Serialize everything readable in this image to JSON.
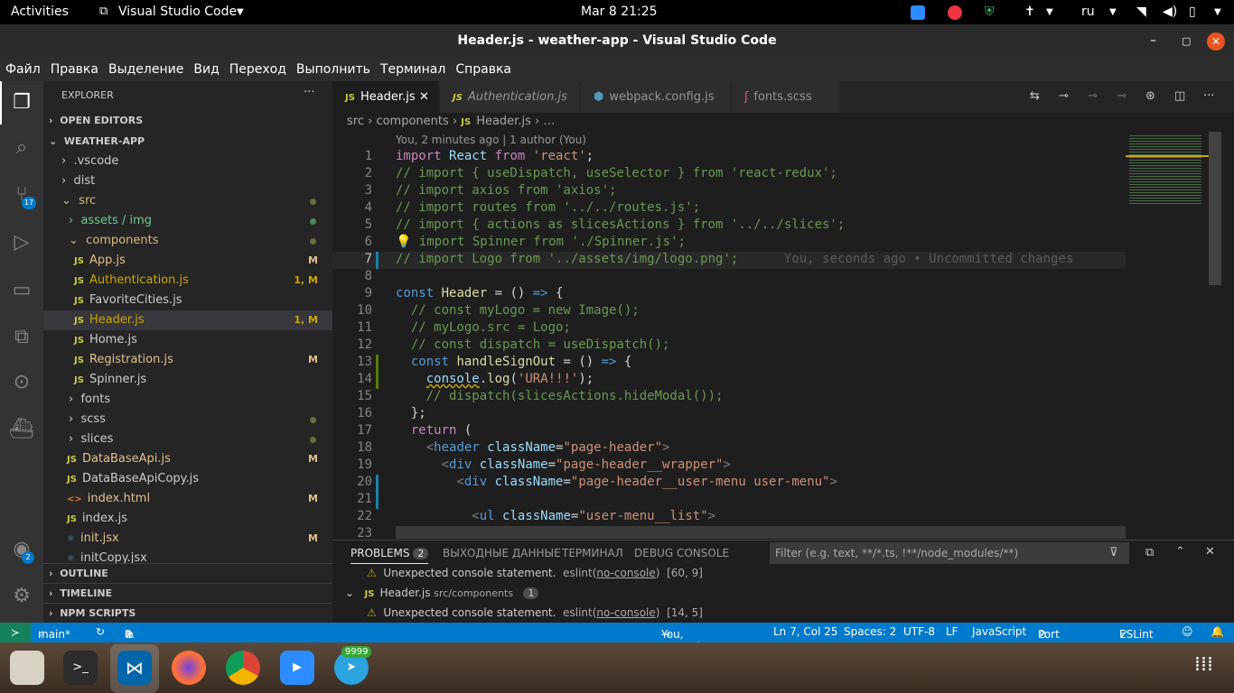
{
  "system": {
    "activities": "Activities",
    "app_menu": "Visual Studio Code",
    "clock": "Mar 8  21:25",
    "lang": "ru"
  },
  "window": {
    "title": "Header.js - weather-app - Visual Studio Code"
  },
  "menu": [
    "Файл",
    "Правка",
    "Выделение",
    "Вид",
    "Переход",
    "Выполнить",
    "Терминал",
    "Справка"
  ],
  "explorer": {
    "title": "EXPLORER",
    "open_editors": "OPEN EDITORS",
    "project": "WEATHER-APP",
    "items": [
      {
        "label": ".vscode",
        "kind": "folder"
      },
      {
        "label": "dist",
        "kind": "folder"
      },
      {
        "label": "src",
        "kind": "folder-open"
      },
      {
        "label": "assets / img",
        "kind": "folder"
      },
      {
        "label": "components",
        "kind": "folder-open"
      },
      {
        "label": "App.js",
        "kind": "js",
        "badge": "M"
      },
      {
        "label": "Authentication.js",
        "kind": "js",
        "badge": "1, M"
      },
      {
        "label": "FavoriteCities.js",
        "kind": "js",
        "badge": ""
      },
      {
        "label": "Header.js",
        "kind": "js",
        "badge": "1, M"
      },
      {
        "label": "Home.js",
        "kind": "js",
        "badge": ""
      },
      {
        "label": "Registration.js",
        "kind": "js",
        "badge": "M"
      },
      {
        "label": "Spinner.js",
        "kind": "js",
        "badge": ""
      },
      {
        "label": "fonts",
        "kind": "folder"
      },
      {
        "label": "scss",
        "kind": "folder"
      },
      {
        "label": "slices",
        "kind": "folder"
      },
      {
        "label": "DataBaseApi.js",
        "kind": "js",
        "badge": "M"
      },
      {
        "label": "DataBaseApiCopy.js",
        "kind": "js",
        "badge": ""
      },
      {
        "label": "index.html",
        "kind": "html",
        "badge": "M"
      },
      {
        "label": "index.js",
        "kind": "js",
        "badge": ""
      },
      {
        "label": "init.jsx",
        "kind": "jsx",
        "badge": "M"
      },
      {
        "label": "initCopy.jsx",
        "kind": "jsx",
        "badge": ""
      }
    ],
    "outline": "OUTLINE",
    "timeline": "TIMELINE",
    "npm": "NPM SCRIPTS"
  },
  "tabs": [
    {
      "label": "Header.js"
    },
    {
      "label": "Authentication.js"
    },
    {
      "label": "webpack.config.js"
    },
    {
      "label": "fonts.scss"
    }
  ],
  "breadcrumb": [
    "src",
    "components",
    "Header.js",
    "…"
  ],
  "blame": "You, 2 minutes ago | 1 author (You)",
  "inline_blame": "You, seconds ago • Uncommitted changes",
  "line_numbers": [
    "1",
    "2",
    "3",
    "4",
    "5",
    "6",
    "7",
    "8",
    "9",
    "10",
    "11",
    "12",
    "13",
    "14",
    "15",
    "16",
    "17",
    "18",
    "19",
    "20",
    "21",
    "22",
    "23"
  ],
  "panel": {
    "tabs": [
      "PROBLEMS",
      "ВЫХОДНЫЕ ДАННЫЕ",
      "ТЕРМИНАЛ",
      "DEBUG CONSOLE"
    ],
    "problems_count": "2",
    "filter_placeholder": "Filter (e.g. text, **/*.ts, !**/node_modules/**)",
    "row1": {
      "msg": "Unexpected console statement.",
      "src": "eslint(",
      "rule": "no-console",
      "end": ")",
      "pos": "[60, 9]"
    },
    "file": {
      "name": "Header.js",
      "path": "src/components",
      "count": "1"
    },
    "row2": {
      "msg": "Unexpected console statement.",
      "src": "eslint(",
      "rule": "no-console",
      "end": ")",
      "pos": "[14, 5]"
    }
  },
  "status": {
    "branch": "main*",
    "errors": "0",
    "warnings": "2",
    "blame": "You, seconds ago",
    "pos": "Ln 7, Col 25",
    "spaces": "Spaces: 2",
    "enc": "UTF-8",
    "eol": "LF",
    "lang": "JavaScript",
    "port": "Port : 5500",
    "eslint": "ESLint"
  },
  "activity_badges": {
    "scm": "17",
    "accounts": "2"
  },
  "dock": {
    "telegram_badge": "9999"
  },
  "colors": {
    "accent": "#007acc",
    "sidebar": "#252526",
    "editor": "#1e1e1e"
  }
}
